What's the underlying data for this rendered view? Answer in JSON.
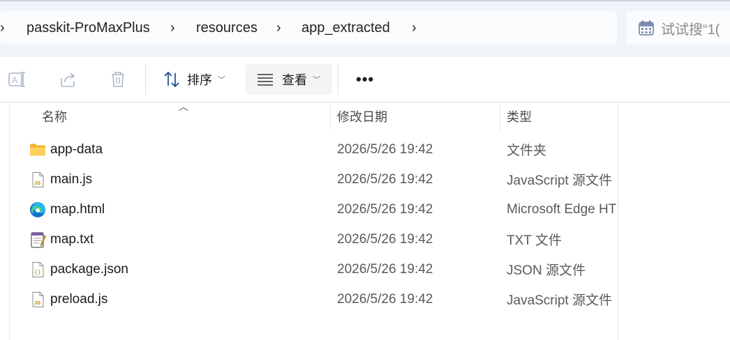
{
  "breadcrumb": {
    "items": [
      "passkit-ProMaxPlus",
      "resources",
      "app_extracted"
    ]
  },
  "search": {
    "placeholder": "试试搜“1("
  },
  "toolbar": {
    "sort_label": "排序",
    "view_label": "查看",
    "more_label": "•••"
  },
  "columns": {
    "name": "名称",
    "modified": "修改日期",
    "type": "类型"
  },
  "files": [
    {
      "name": "app-data",
      "modified": "2026/5/26 19:42",
      "type": "文件夹",
      "icon": "folder-icon"
    },
    {
      "name": "main.js",
      "modified": "2026/5/26 19:42",
      "type": "JavaScript 源文件",
      "icon": "js-file-icon"
    },
    {
      "name": "map.html",
      "modified": "2026/5/26 19:42",
      "type": "Microsoft Edge HT",
      "icon": "edge-icon"
    },
    {
      "name": "map.txt",
      "modified": "2026/5/26 19:42",
      "type": "TXT 文件",
      "icon": "notepad-icon"
    },
    {
      "name": "package.json",
      "modified": "2026/5/26 19:42",
      "type": "JSON 源文件",
      "icon": "json-file-icon"
    },
    {
      "name": "preload.js",
      "modified": "2026/5/26 19:42",
      "type": "JavaScript 源文件",
      "icon": "js-file-icon"
    }
  ],
  "colors": {
    "accent": "#0067c0",
    "folder": "#f8c73e",
    "address_bg": "#eff4f9"
  }
}
